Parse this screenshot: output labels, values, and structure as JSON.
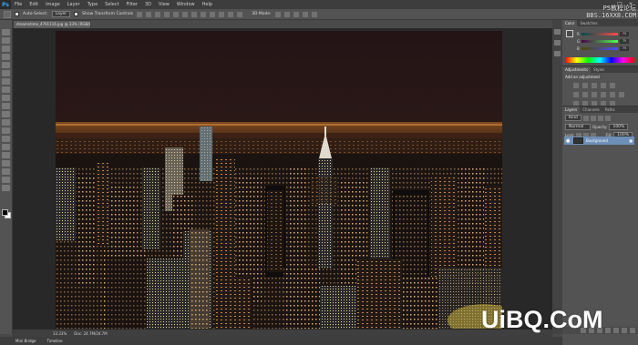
{
  "app": {
    "logo": "Ps"
  },
  "menu": [
    "File",
    "Edit",
    "Image",
    "Layer",
    "Type",
    "Select",
    "Filter",
    "3D",
    "View",
    "Window",
    "Help"
  ],
  "window_controls": [
    "_",
    "□",
    "×"
  ],
  "options": {
    "auto_select_label": "Auto-Select:",
    "auto_select_value": "Layer",
    "show_transform_label": "Show Transform Controls",
    "mode_label": "3D Mode:"
  },
  "document": {
    "tab_title": "dreamstime_4791116.jpg @ 33% (RGB/8*) ×"
  },
  "status": {
    "zoom": "33.33%",
    "doc_size": "Doc: 24.7M/24.7M"
  },
  "bottom_tabs": [
    "Mini Bridge",
    "Timeline"
  ],
  "color_panel": {
    "tabs": [
      "Color",
      "Swatches"
    ],
    "sliders": [
      {
        "label": "R",
        "value": "75"
      },
      {
        "label": "G",
        "value": "75"
      },
      {
        "label": "B",
        "value": "75"
      }
    ]
  },
  "adjustments_panel": {
    "tabs": [
      "Adjustments",
      "Styles"
    ],
    "heading": "Add an adjustment"
  },
  "layers_panel": {
    "tabs": [
      "Layers",
      "Channels",
      "Paths"
    ],
    "filter_label": "Kind",
    "blend_mode": "Normal",
    "opacity_label": "Opacity:",
    "opacity_value": "100%",
    "lock_label": "Lock:",
    "fill_label": "Fill:",
    "fill_value": "100%",
    "layers": [
      {
        "name": "Background"
      }
    ]
  },
  "watermarks": {
    "top_line1": "PS教程论坛",
    "top_line2": "BBS.16XX8.COM",
    "bottom": "UiBQ.CoM"
  },
  "colors": {
    "foreground": "#000000",
    "background": "#ffffff",
    "layer_selected": "#6d8fb8"
  }
}
